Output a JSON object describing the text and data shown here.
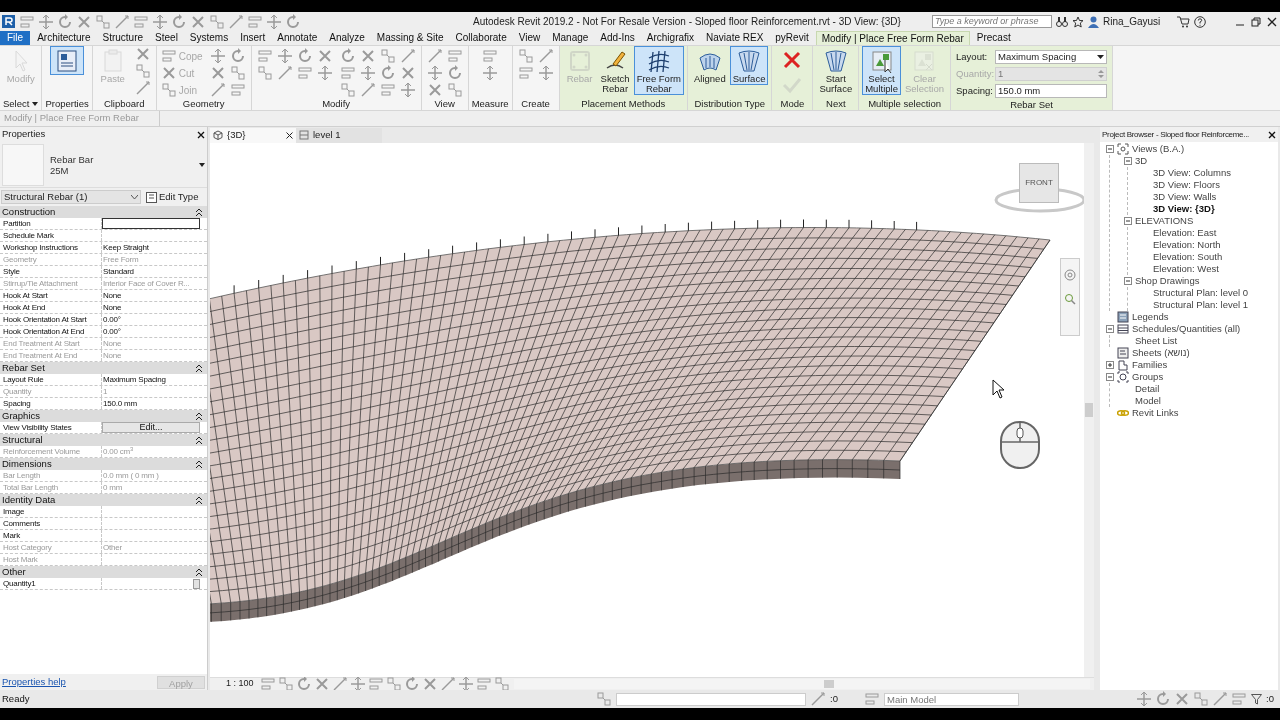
{
  "title_bar": {
    "title": "Autodesk Revit 2019.2 - Not For Resale Version - Sloped floor Reinforcement.rvt - 3D View: {3D}",
    "search_placeholder": "Type a keyword or phrase",
    "user": "Rina_Gayusi"
  },
  "tabs": [
    {
      "label": "File",
      "selected": false,
      "kind": "file"
    },
    {
      "label": "Architecture",
      "selected": false,
      "kind": "tab"
    },
    {
      "label": "Structure",
      "selected": false,
      "kind": "tab"
    },
    {
      "label": "Steel",
      "selected": false,
      "kind": "tab"
    },
    {
      "label": "Systems",
      "selected": false,
      "kind": "tab"
    },
    {
      "label": "Insert",
      "selected": false,
      "kind": "tab"
    },
    {
      "label": "Annotate",
      "selected": false,
      "kind": "tab"
    },
    {
      "label": "Analyze",
      "selected": false,
      "kind": "tab"
    },
    {
      "label": "Massing & Site",
      "selected": false,
      "kind": "tab"
    },
    {
      "label": "Collaborate",
      "selected": false,
      "kind": "tab"
    },
    {
      "label": "View",
      "selected": false,
      "kind": "tab"
    },
    {
      "label": "Manage",
      "selected": false,
      "kind": "tab"
    },
    {
      "label": "Add-Ins",
      "selected": false,
      "kind": "tab"
    },
    {
      "label": "Archigrafix",
      "selected": false,
      "kind": "tab"
    },
    {
      "label": "Naviate REX",
      "selected": false,
      "kind": "tab"
    },
    {
      "label": "pyRevit",
      "selected": false,
      "kind": "tab"
    },
    {
      "label": "Modify | Place Free Form Rebar",
      "selected": true,
      "kind": "contextual"
    },
    {
      "label": "Precast",
      "selected": false,
      "kind": "tab"
    }
  ],
  "ribbon": {
    "panels": [
      {
        "title": "Select",
        "kind": "tools",
        "contextual": false,
        "menu": true,
        "tools": [
          {
            "label": "Modify",
            "kind": "cursor",
            "active": false,
            "disabled": true
          }
        ]
      },
      {
        "title": "Properties",
        "kind": "tools",
        "contextual": false,
        "menu": false,
        "tools": [
          {
            "kind": "properties",
            "active": true,
            "disabled": false
          }
        ]
      },
      {
        "title": "Clipboard",
        "kind": "clipboard",
        "contextual": false,
        "menu": false,
        "tools": [
          {
            "label": "Paste",
            "kind": "paste",
            "active": false,
            "disabled": true
          }
        ]
      },
      {
        "title": "Geometry",
        "kind": "geometry",
        "contextual": false,
        "menu": false,
        "tools": [
          {
            "label": "Cope",
            "kind": "cope",
            "active": false,
            "disabled": true
          },
          {
            "label": "Cut",
            "kind": "cut",
            "active": false,
            "disabled": true
          },
          {
            "label": "Join",
            "kind": "join",
            "active": false,
            "disabled": true
          }
        ]
      },
      {
        "title": "Modify",
        "kind": "modify",
        "contextual": false,
        "menu": false
      },
      {
        "title": "View",
        "kind": "view",
        "contextual": false,
        "menu": false
      },
      {
        "title": "Measure",
        "kind": "measure",
        "contextual": false,
        "menu": false
      },
      {
        "title": "Create",
        "kind": "create",
        "contextual": false,
        "menu": false
      },
      {
        "title": "Placement Methods",
        "kind": "tools",
        "contextual": true,
        "menu": false,
        "tools": [
          {
            "label": "Rebar",
            "kind": "rebar",
            "active": false,
            "disabled": true
          },
          {
            "label": "Sketch\nRebar",
            "kind": "sketch",
            "active": false,
            "disabled": false
          },
          {
            "label": "Free Form\nRebar",
            "kind": "freeform",
            "active": true,
            "disabled": false
          }
        ]
      },
      {
        "title": "Distribution Type",
        "kind": "tools",
        "contextual": true,
        "menu": false,
        "tools": [
          {
            "label": "Aligned",
            "kind": "aligned",
            "active": false,
            "disabled": false
          },
          {
            "label": "Surface",
            "kind": "surface",
            "active": true,
            "disabled": false
          }
        ]
      },
      {
        "title": "Mode",
        "kind": "stack",
        "contextual": true,
        "menu": false,
        "tools": [
          {
            "kind": "cancel",
            "active": false,
            "disabled": false
          },
          {
            "kind": "finish",
            "active": false,
            "disabled": true
          }
        ]
      },
      {
        "title": "Next",
        "kind": "tools",
        "contextual": true,
        "menu": false,
        "tools": [
          {
            "label": "Start\nSurface",
            "kind": "start_surface",
            "active": false,
            "disabled": false
          }
        ]
      },
      {
        "title": "Multiple selection",
        "kind": "tools",
        "contextual": true,
        "menu": false,
        "tools": [
          {
            "label": "Select\nMultiple",
            "kind": "select_multiple",
            "active": true,
            "disabled": false
          },
          {
            "label": "Clear\nSelection",
            "kind": "clear_selection",
            "active": false,
            "disabled": true
          }
        ]
      },
      {
        "title": "Rebar Set",
        "kind": "fields",
        "contextual": true,
        "menu": false,
        "fields": [
          {
            "label": "Layout:",
            "value": "Maximum Spacing",
            "kind": "dropdown",
            "disabled": false
          },
          {
            "label": "Quantity:",
            "value": "1",
            "kind": "spinner",
            "disabled": true
          },
          {
            "label": "Spacing:",
            "value": "150.0 mm",
            "kind": "text",
            "disabled": false
          }
        ]
      }
    ]
  },
  "modify_bar": {
    "text": "Modify | Place Free Form Rebar"
  },
  "properties": {
    "title": "Properties",
    "type_lines": [
      "Rebar Bar",
      "25M"
    ],
    "filter": "Structural Rebar (1)",
    "edit_type": "Edit Type",
    "groups": [
      {
        "name": "Construction",
        "expanded": true,
        "rows": [
          {
            "label": "Partition",
            "kind": "input",
            "disabled": false
          },
          {
            "label": "Schedule Mark",
            "kind": "text",
            "disabled": false
          },
          {
            "label": "Workshop Instructions",
            "value": "Keep Straight",
            "kind": "text",
            "disabled": false
          },
          {
            "label": "Geometry",
            "value": "Free Form",
            "kind": "text",
            "disabled": true
          },
          {
            "label": "Style",
            "value": "Standard",
            "kind": "text",
            "disabled": false
          },
          {
            "label": "Stirrup/Tie Attachment",
            "value": "Interior Face of Cover R...",
            "kind": "text",
            "disabled": true
          },
          {
            "label": "Hook At Start",
            "value": "None",
            "kind": "text",
            "disabled": false
          },
          {
            "label": "Hook At End",
            "value": "None",
            "kind": "text",
            "disabled": false
          },
          {
            "label": "Hook Orientation At Start",
            "value": "0.00°",
            "kind": "text",
            "disabled": false
          },
          {
            "label": "Hook Orientation At End",
            "value": "0.00°",
            "kind": "text",
            "disabled": false
          },
          {
            "label": "End Treatment At Start",
            "value": "None",
            "kind": "text",
            "disabled": true
          },
          {
            "label": "End Treatment At End",
            "value": "None",
            "kind": "text",
            "disabled": true
          }
        ]
      },
      {
        "name": "Rebar Set",
        "expanded": true,
        "rows": [
          {
            "label": "Layout Rule",
            "value": "Maximum Spacing",
            "kind": "text",
            "disabled": false
          },
          {
            "label": "Quantity",
            "value": "1",
            "kind": "text",
            "disabled": true
          },
          {
            "label": "Spacing",
            "value": "150.0 mm",
            "kind": "text",
            "disabled": false
          }
        ]
      },
      {
        "name": "Graphics",
        "expanded": true,
        "rows": [
          {
            "label": "View Visibility States",
            "value": "Edit...",
            "kind": "button",
            "disabled": false
          }
        ]
      },
      {
        "name": "Structural",
        "expanded": true,
        "rows": [
          {
            "label": "Reinforcement Volume",
            "value": "0.00 cm$^{3}$",
            "kind": "text",
            "disabled": true
          }
        ]
      },
      {
        "name": "Dimensions",
        "expanded": true,
        "rows": [
          {
            "label": "Bar Length",
            "value": "0.0 mm ( 0 mm )",
            "kind": "text",
            "disabled": true
          },
          {
            "label": "Total Bar Length",
            "value": "0 mm",
            "kind": "text",
            "disabled": true
          }
        ]
      },
      {
        "name": "Identity Data",
        "expanded": true,
        "rows": [
          {
            "label": "Image",
            "kind": "text",
            "disabled": false
          },
          {
            "label": "Comments",
            "kind": "text",
            "disabled": false
          },
          {
            "label": "Mark",
            "kind": "text",
            "disabled": false
          },
          {
            "label": "Host Category",
            "value": "Other",
            "kind": "text",
            "disabled": true
          },
          {
            "label": "Host Mark",
            "kind": "text",
            "disabled": true
          }
        ]
      },
      {
        "name": "Other",
        "expanded": true,
        "rows": [
          {
            "label": "Quantity1",
            "kind": "browse",
            "disabled": false
          }
        ]
      }
    ],
    "help": "Properties help",
    "apply": {
      "label": "Apply",
      "disabled": true
    }
  },
  "view": {
    "tabs": [
      {
        "label": "{3D}",
        "selected": true,
        "kind": "perspective"
      },
      {
        "label": "level 1",
        "selected": false,
        "kind": "plan"
      }
    ],
    "cube_label": "FRONT",
    "scale": "1 : 100"
  },
  "browser": {
    "title": "Project Browser - Sloped floor Reinforceme...",
    "tree": [
      {
        "label": "Views (B.A.)",
        "kind": "views",
        "expanded": true,
        "current": false,
        "children": [
          {
            "label": "3D",
            "expanded": true,
            "current": false,
            "children": [
              {
                "label": "3D View: Columns",
                "current": false
              },
              {
                "label": "3D View: Floors",
                "current": false
              },
              {
                "label": "3D View: Walls",
                "current": false
              },
              {
                "label": "3D View: {3D}",
                "current": true
              }
            ]
          },
          {
            "label": "ELEVATIONS",
            "expanded": true,
            "current": false,
            "children": [
              {
                "label": "Elevation: East",
                "current": false
              },
              {
                "label": "Elevation: North",
                "current": false
              },
              {
                "label": "Elevation: South",
                "current": false
              },
              {
                "label": "Elevation: West",
                "current": false
              }
            ]
          },
          {
            "label": "Shop Drawings",
            "expanded": true,
            "current": false,
            "children": [
              {
                "label": "Structural Plan: level 0",
                "current": false
              },
              {
                "label": "Structural Plan: level 1",
                "current": false
              }
            ]
          }
        ]
      },
      {
        "label": "Legends",
        "kind": "legends",
        "current": false
      },
      {
        "label": "Schedules/Quantities (all)",
        "kind": "schedules",
        "expanded": true,
        "current": false,
        "children": [
          {
            "label": "Sheet List",
            "current": false
          }
        ]
      },
      {
        "label": "Sheets (נושא)",
        "kind": "sheets",
        "current": false
      },
      {
        "label": "Families",
        "kind": "families",
        "expanded": false,
        "current": false
      },
      {
        "label": "Groups",
        "kind": "groups",
        "expanded": true,
        "current": false,
        "children": [
          {
            "label": "Detail",
            "current": false
          },
          {
            "label": "Model",
            "current": false
          }
        ]
      },
      {
        "label": "Revit Links",
        "kind": "links",
        "current": false
      }
    ]
  },
  "status_bar": {
    "text": "Ready",
    "workset_count": ":0",
    "model": "Main Model",
    "filter_count": ":0"
  }
}
